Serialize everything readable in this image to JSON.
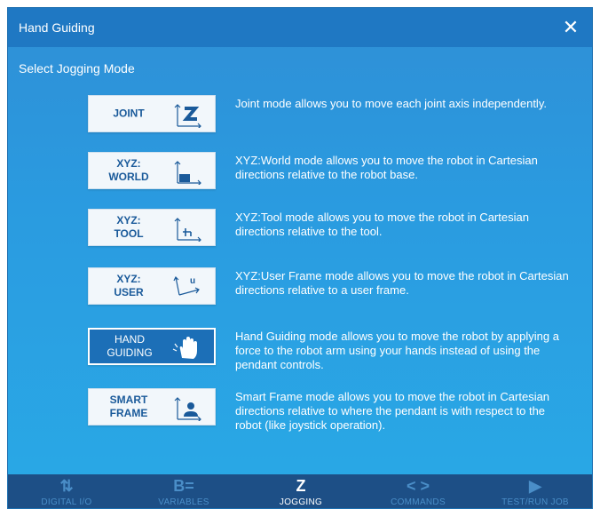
{
  "dialog": {
    "title": "Hand Guiding",
    "close_icon": "close-icon",
    "subtitle": "Select Jogging Mode"
  },
  "modes": [
    {
      "label": "JOINT",
      "icon": "joint-icon",
      "selected": false,
      "description": "Joint mode allows you to move each joint axis independently."
    },
    {
      "label": "XYZ:\nWORLD",
      "icon": "world-frame-icon",
      "selected": false,
      "description": "XYZ:World mode allows you to move the robot in Cartesian directions relative to the robot base."
    },
    {
      "label": "XYZ:\nTOOL",
      "icon": "tool-frame-icon",
      "selected": false,
      "description": "XYZ:Tool mode allows you to move the robot in Cartesian directions relative to the tool."
    },
    {
      "label": "XYZ:\nUSER",
      "icon": "user-frame-icon",
      "selected": false,
      "description": "XYZ:User Frame mode allows you to move the robot in Cartesian directions relative to a user frame."
    },
    {
      "label": "HAND\nGUIDING",
      "icon": "hand-icon",
      "selected": true,
      "description": "Hand Guiding mode allows you to move the robot by applying a force to the robot arm using your hands instead of using the pendant controls."
    },
    {
      "label": "SMART\nFRAME",
      "icon": "smart-frame-icon",
      "selected": false,
      "description": "Smart Frame mode allows you to move the robot in Cartesian directions relative to where the pendant is with respect to the robot (like joystick operation)."
    }
  ],
  "bottom_nav": [
    {
      "label": "DIGITAL I/O",
      "icon": "digital-io-icon",
      "active": false
    },
    {
      "label": "VARIABLES",
      "icon": "variables-icon",
      "active": false
    },
    {
      "label": "JOGGING",
      "icon": "jogging-icon",
      "active": true
    },
    {
      "label": "COMMANDS",
      "icon": "commands-icon",
      "active": false
    },
    {
      "label": "TEST/RUN JOB",
      "icon": "play-icon",
      "active": false
    }
  ]
}
